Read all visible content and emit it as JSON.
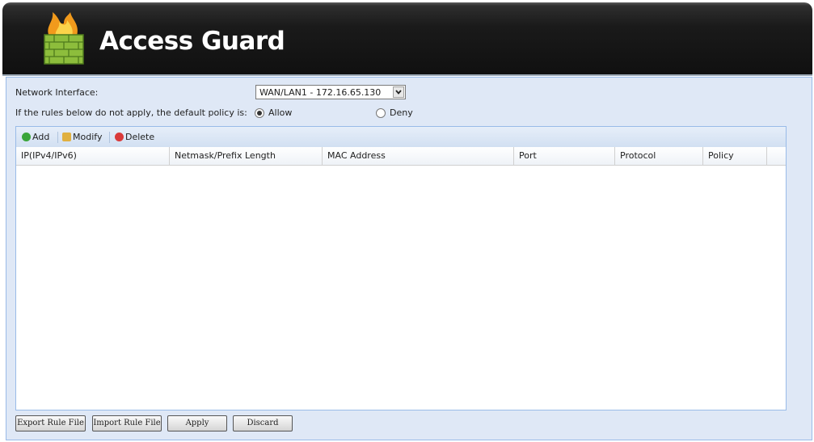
{
  "header": {
    "title": "Access Guard"
  },
  "form": {
    "network_interface_label": "Network Interface:",
    "network_interface_value": "WAN/LAN1 - 172.16.65.130",
    "default_policy_label": "If the rules below do not apply, the default policy is:",
    "policy_options": [
      {
        "label": "Allow",
        "selected": true
      },
      {
        "label": "Deny",
        "selected": false
      }
    ]
  },
  "toolbar": {
    "add_label": "Add",
    "modify_label": "Modify",
    "delete_label": "Delete"
  },
  "table": {
    "columns": [
      "IP(IPv4/IPv6)",
      "Netmask/Prefix Length",
      "MAC Address",
      "Port",
      "Protocol",
      "Policy"
    ],
    "rows": []
  },
  "footer": {
    "export_label": "Export Rule File",
    "import_label": "Import Rule File",
    "apply_label": "Apply",
    "discard_label": "Discard"
  },
  "colors": {
    "panel_bg": "#dfe8f6",
    "border": "#99bbe8",
    "header_bg": "#101010",
    "add_icon": "#3aa53a",
    "delete_icon": "#d93a3a"
  },
  "icons": {
    "logo": "firewall-icon",
    "add": "add-icon",
    "modify": "modify-icon",
    "delete": "delete-icon",
    "dropdown": "chevron-down-icon"
  }
}
